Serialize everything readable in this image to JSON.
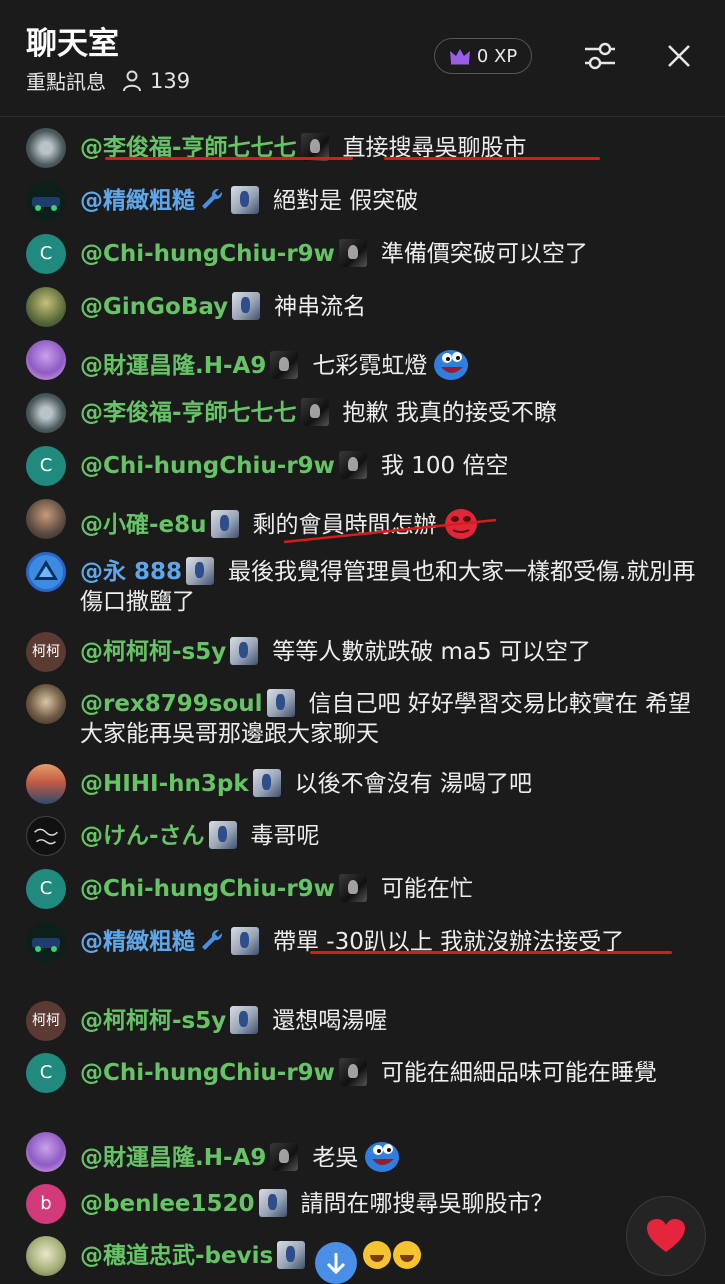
{
  "header": {
    "title": "聊天室",
    "subtitle": "重點訊息",
    "viewer_count": "139",
    "xp_label": "0 XP"
  },
  "colors": {
    "background": "#1b1b1b",
    "username_green": "#66c466",
    "username_blue": "#5ea7ea",
    "underline_red": "#d51d1d",
    "xp_crown": "#9b5de5"
  },
  "messages": [
    {
      "username": "@李俊福-亨師七七七",
      "text": "直接搜尋吳聊股市"
    },
    {
      "username": "@精緻粗糙",
      "text": "絕對是 假突破"
    },
    {
      "username": "@Chi-hungChiu-r9w",
      "text": "準備價突破可以空了",
      "avatar_letter": "C"
    },
    {
      "username": "@GinGoBay",
      "text": "神串流名"
    },
    {
      "username": "@財運昌隆.H-A9",
      "text": "七彩霓虹燈"
    },
    {
      "username": "@李俊福-亨師七七七",
      "text": "抱歉 我真的接受不瞭"
    },
    {
      "username": "@Chi-hungChiu-r9w",
      "text": "我 100 倍空",
      "avatar_letter": "C"
    },
    {
      "username": "@小確-e8u",
      "text": "剩的會員時間怎辦"
    },
    {
      "username": "@永 888",
      "text": "最後我覺得管理員也和大家一樣都受傷.就別再傷口撒鹽了"
    },
    {
      "username": "@柯柯柯-s5y",
      "text": "等等人數就跌破 ma5 可以空了",
      "avatar_letter": "柯柯"
    },
    {
      "username": "@rex8799soul",
      "text": "信自己吧 好好學習交易比較實在 希望大家能再吳哥那邊跟大家聊天"
    },
    {
      "username": "@HIHI-hn3pk",
      "text": "以後不會沒有 湯喝了吧"
    },
    {
      "username": "@けん-さん",
      "text": "毒哥呢"
    },
    {
      "username": "@Chi-hungChiu-r9w",
      "text": "可能在忙",
      "avatar_letter": "C"
    },
    {
      "username": "@精緻粗糙",
      "text": "帶單 -30趴以上 我就沒辦法接受了"
    },
    {
      "username": "@柯柯柯-s5y",
      "text": "還想喝湯喔",
      "avatar_letter": "柯柯"
    },
    {
      "username": "@Chi-hungChiu-r9w",
      "text": "可能在細細品味可能在睡覺",
      "avatar_letter": "C"
    },
    {
      "username": "@財運昌隆.H-A9",
      "text": "老吳"
    },
    {
      "username": "@benlee1520",
      "text": "請問在哪搜尋吳聊股市？",
      "avatar_letter": "b"
    },
    {
      "username": "@穗道忠武-bevis",
      "text": ""
    }
  ]
}
